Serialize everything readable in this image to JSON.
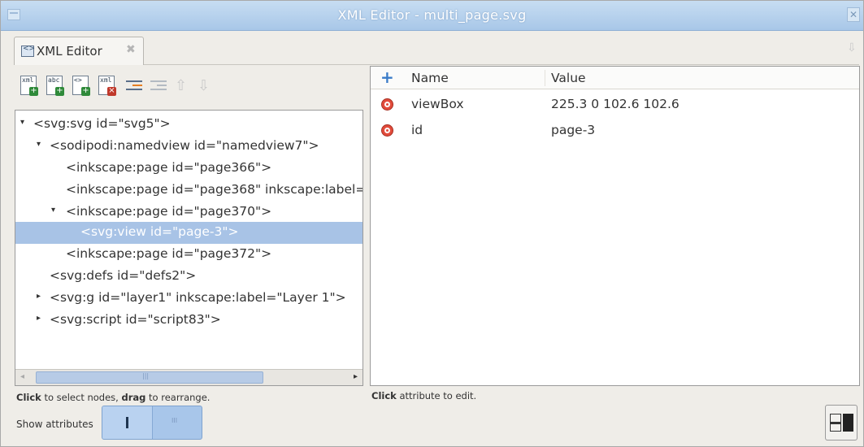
{
  "window": {
    "title": "XML Editor - multi_page.svg"
  },
  "tab": {
    "label": "XML Editor"
  },
  "toolbar": {
    "new_element_label": "xml",
    "new_text_label": "abc",
    "delete_label": "xml"
  },
  "tree": {
    "nodes": [
      {
        "text": "<svg:svg id=\"svg5\">",
        "expander": "▾",
        "selected": false
      },
      {
        "text": "<sodipodi:namedview id=\"namedview7\">",
        "expander": "▾",
        "selected": false
      },
      {
        "text": "<inkscape:page id=\"page366\">",
        "expander": "",
        "selected": false
      },
      {
        "text": "<inkscape:page id=\"page368\" inkscape:label=\"",
        "expander": "",
        "selected": false
      },
      {
        "text": "<inkscape:page id=\"page370\">",
        "expander": "▾",
        "selected": false
      },
      {
        "text": "<svg:view id=\"page-3\">",
        "expander": "",
        "selected": true
      },
      {
        "text": "<inkscape:page id=\"page372\">",
        "expander": "",
        "selected": false
      },
      {
        "text": "<svg:defs id=\"defs2\">",
        "expander": "",
        "selected": false
      },
      {
        "text": "<svg:g id=\"layer1\" inkscape:label=\"Layer 1\">",
        "expander": "▸",
        "selected": false
      },
      {
        "text": "<svg:script id=\"script83\">",
        "expander": "▸",
        "selected": false
      }
    ]
  },
  "left_hint": {
    "bold1": "Click",
    "mid": " to select nodes, ",
    "bold2": "drag",
    "end": " to rearrange."
  },
  "show_attributes": {
    "label": "Show attributes"
  },
  "attributes": {
    "header_name": "Name",
    "header_value": "Value",
    "rows": [
      {
        "name": "viewBox",
        "value": "225.3 0 102.6 102.6"
      },
      {
        "name": "id",
        "value": "page-3"
      }
    ]
  },
  "right_hint": {
    "bold": "Click",
    "rest": " attribute to edit."
  },
  "colors": {
    "selection": "#a8c3e6",
    "titlebar": "#a8c7e8",
    "delete": "#e24b3b",
    "add": "#3a7bc8"
  },
  "icons": [
    "window-icon",
    "close-icon",
    "xml-editor-icon",
    "new-element-icon",
    "new-text-icon",
    "duplicate-icon",
    "delete-node-icon",
    "unindent-icon",
    "indent-icon",
    "raise-icon",
    "lower-icon",
    "add-attribute-icon",
    "delete-attribute-icon",
    "layout-toggle-icon"
  ]
}
